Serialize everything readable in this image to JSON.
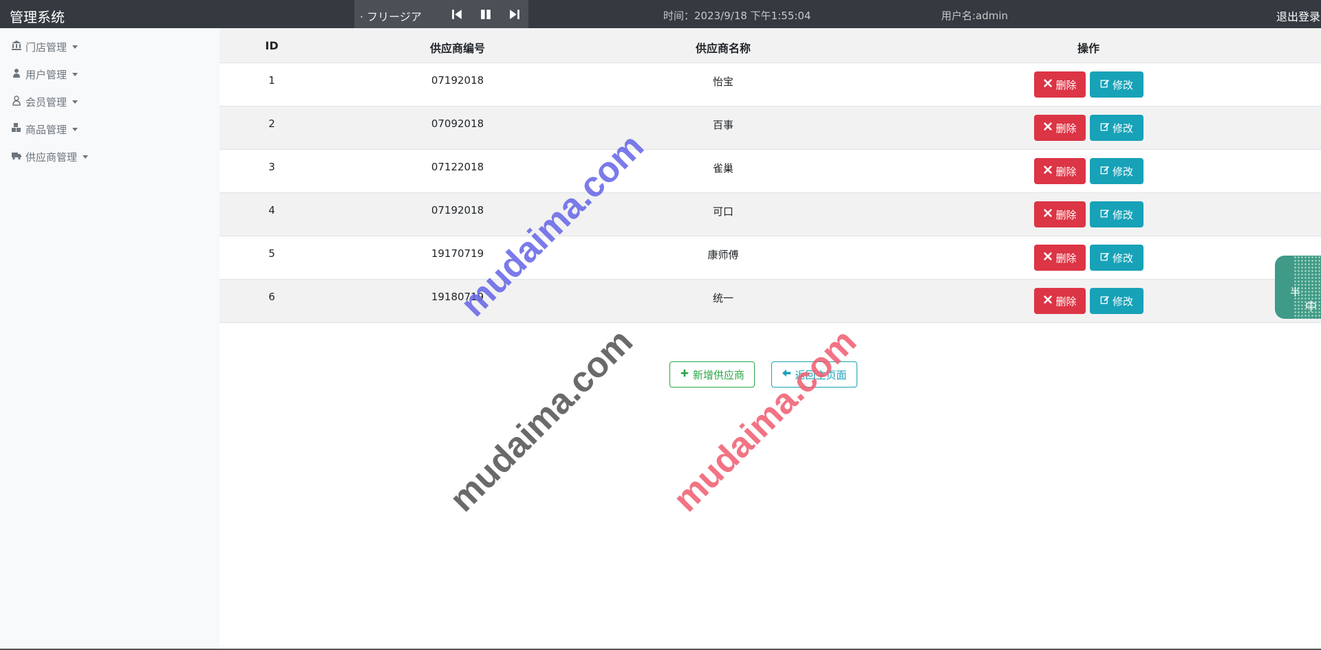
{
  "topbar": {
    "brand": "管理系统",
    "player": {
      "song": "· フリージア",
      "prev_icon": "skip-back-icon",
      "pause_icon": "pause-icon",
      "next_icon": "skip-forward-icon"
    },
    "time": "时间：2023/9/18 下午1:55:04",
    "user": "用户名:admin",
    "logout": "退出登录"
  },
  "sidebar": {
    "items": [
      {
        "label": "门店管理",
        "icon": "bank-icon"
      },
      {
        "label": "用户管理",
        "icon": "user-icon"
      },
      {
        "label": "会员管理",
        "icon": "user-outline-icon"
      },
      {
        "label": "商品管理",
        "icon": "cubes-icon"
      },
      {
        "label": "供应商管理",
        "icon": "truck-icon"
      }
    ]
  },
  "table": {
    "headers": [
      "ID",
      "供应商编号",
      "供应商名称",
      "操作"
    ],
    "rows": [
      {
        "id": "1",
        "code": "07192018",
        "name": "怡宝"
      },
      {
        "id": "2",
        "code": "07092018",
        "name": "百事"
      },
      {
        "id": "3",
        "code": "07122018",
        "name": "雀巢"
      },
      {
        "id": "4",
        "code": "07192018",
        "name": "可口"
      },
      {
        "id": "5",
        "code": "19170719",
        "name": "康师傅"
      },
      {
        "id": "6",
        "code": "19180719",
        "name": "统一"
      }
    ],
    "delete_label": "删除",
    "edit_label": "修改"
  },
  "actions": {
    "add_label": "新增供应商",
    "back_label": "返回主页面"
  },
  "watermark": "mudaima.com",
  "widget": {
    "char1": "半",
    "char2": "中"
  },
  "colors": {
    "danger": "#dc3545",
    "info": "#17a2b8",
    "success": "#28a745",
    "topbar": "#343a40"
  }
}
